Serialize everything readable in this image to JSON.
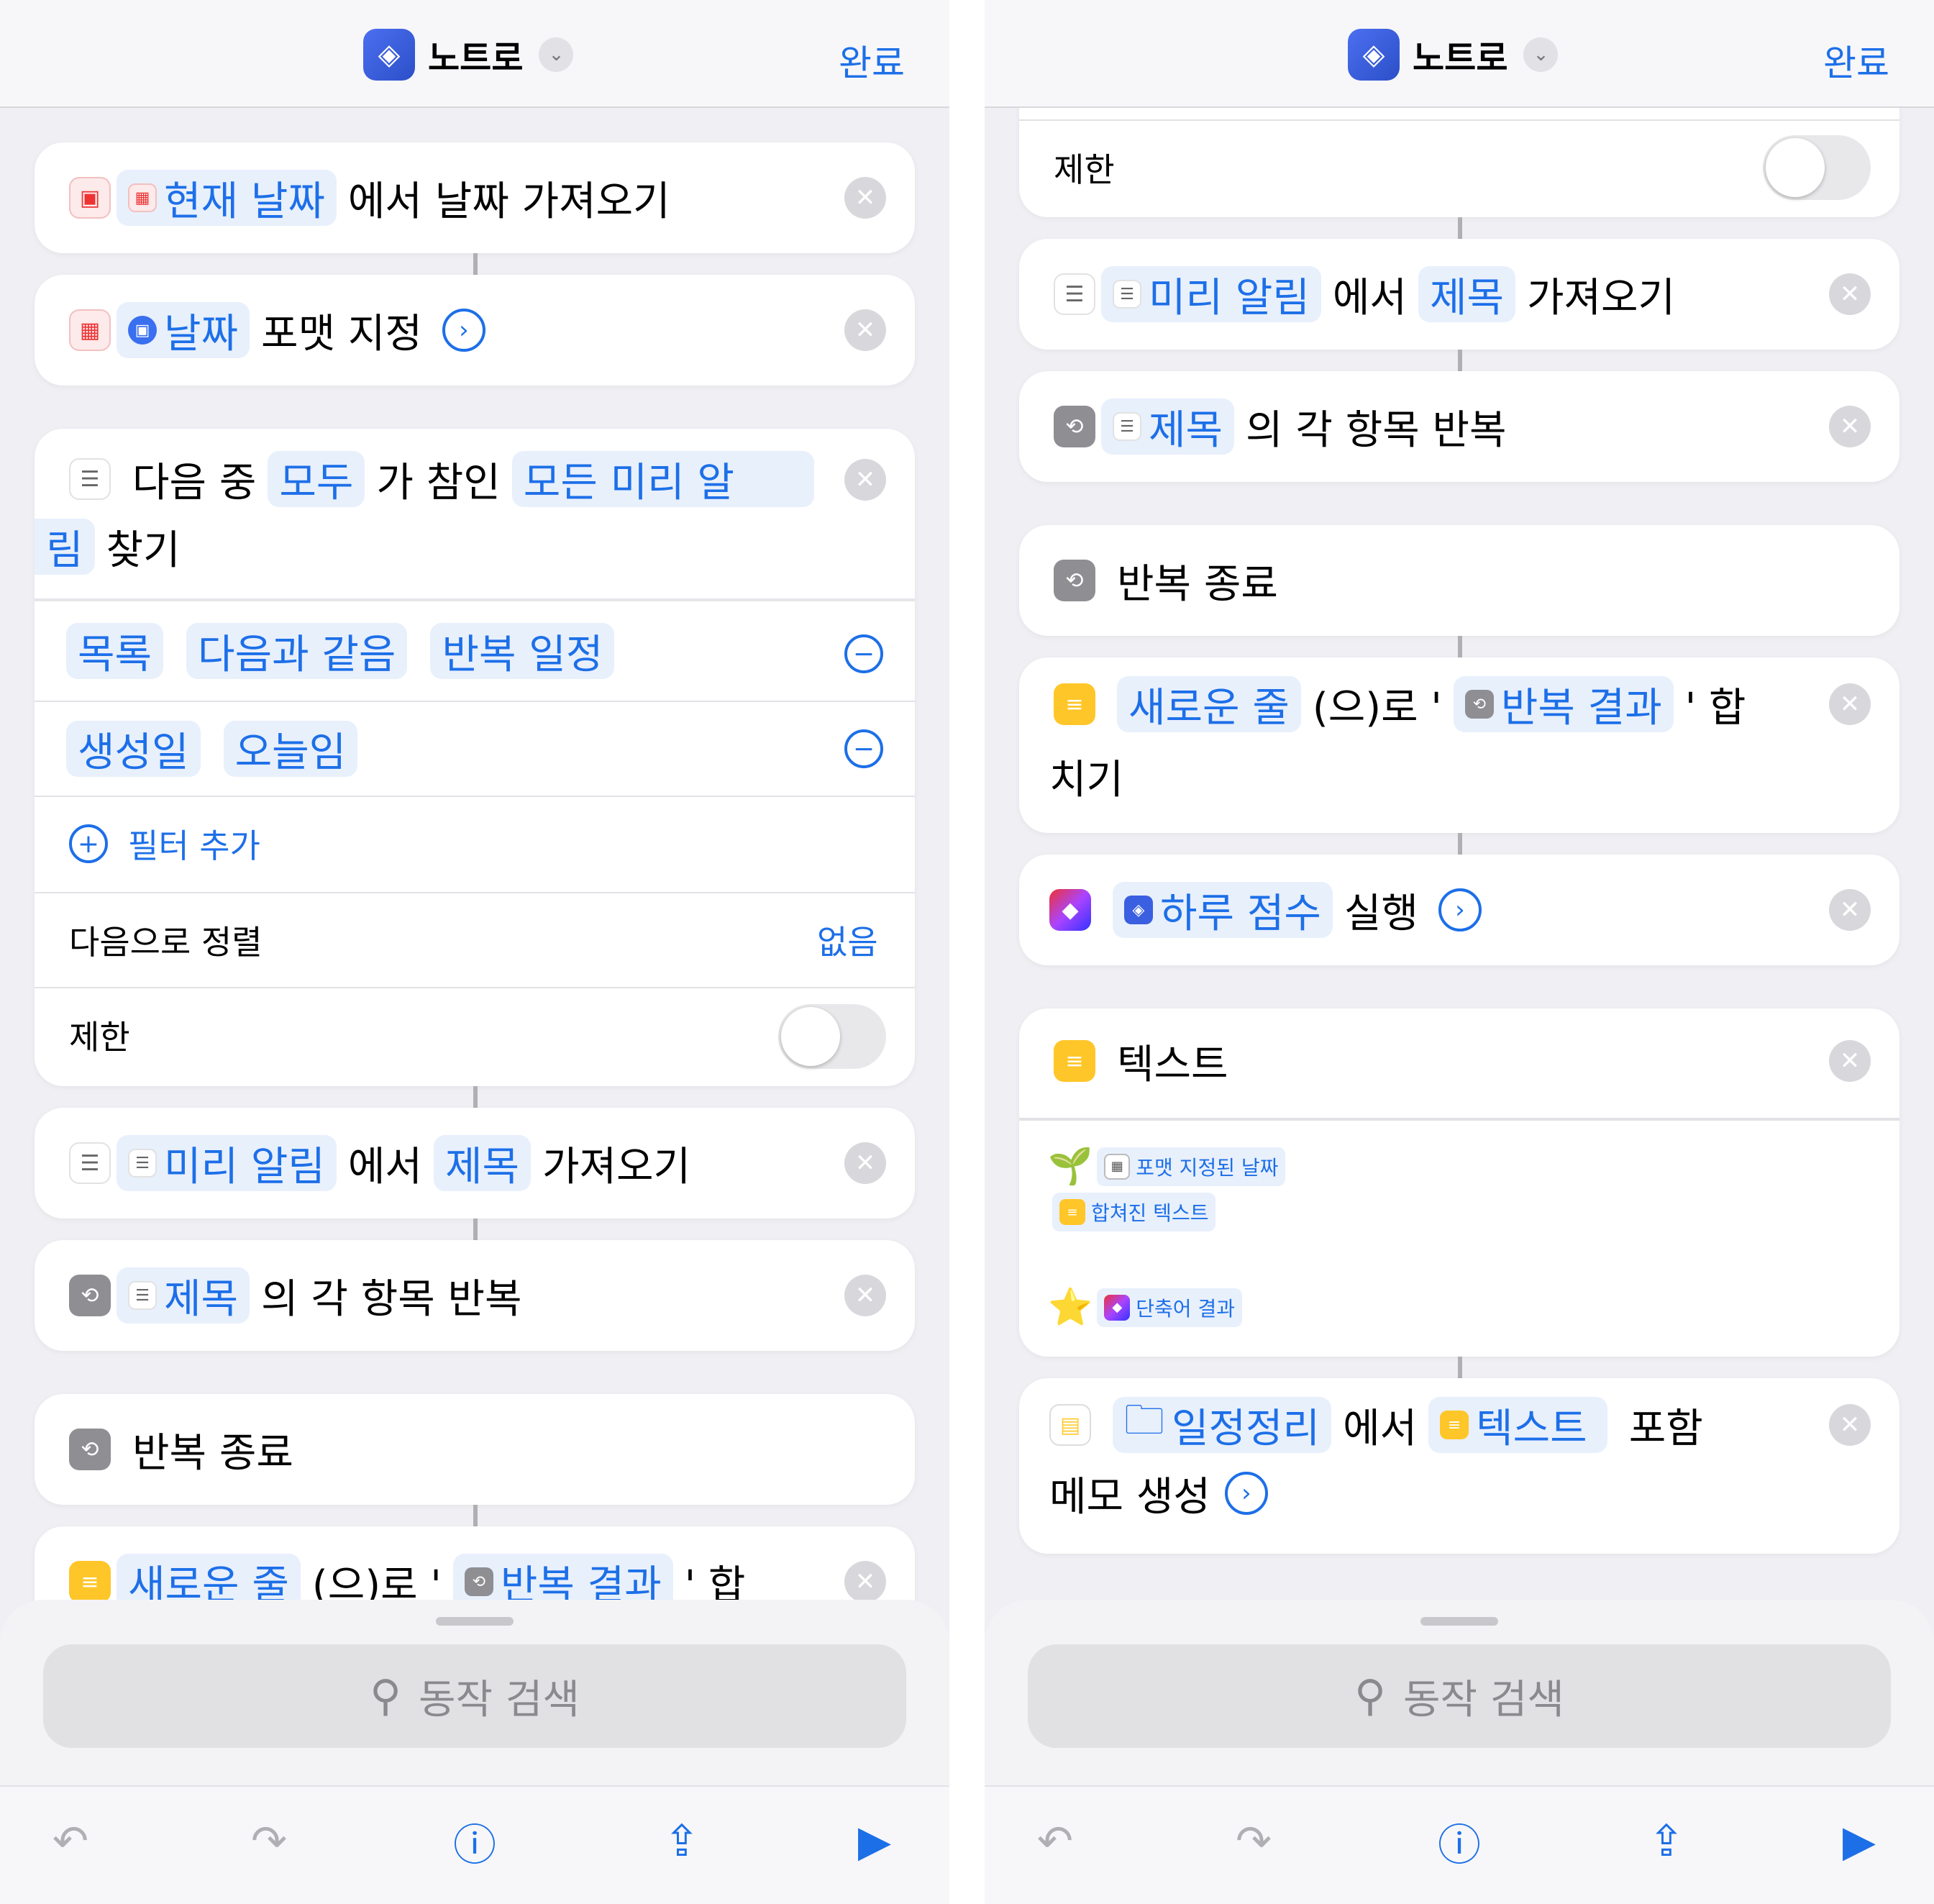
{
  "header": {
    "title": "노트로",
    "done_label": "완료"
  },
  "search": {
    "placeholder": "동작 검색"
  },
  "left": {
    "a1": {
      "token": "현재 날짜",
      "text": "에서 날짜 가져오기"
    },
    "a2": {
      "token": "날짜",
      "text": "포맷 지정"
    },
    "find": {
      "t1": "다음 중",
      "tok_all": "모두",
      "t2": "가 참인",
      "tok_rem_a": "모든 미리 알",
      "tok_rem_b": "림",
      "t3": "찾기"
    },
    "filter1": {
      "a": "목록",
      "b": "다음과 같음",
      "c": "반복 일정"
    },
    "filter2": {
      "a": "생성일",
      "b": "오늘임"
    },
    "add_filter": "필터 추가",
    "sort": {
      "label": "다음으로 정렬",
      "value": "없음"
    },
    "limit": "제한",
    "get": {
      "tok_a": "미리 알림",
      "t1": "에서",
      "tok_b": "제목",
      "t2": "가져오기"
    },
    "repeat": {
      "tok": "제목",
      "text": "의 각 항목 반복"
    },
    "end_repeat": "반복 종료",
    "combine": {
      "tok_a": "새로운 줄",
      "t1": "(으)로 '",
      "tok_b": "반복 결과",
      "t2": "' 합"
    }
  },
  "right": {
    "limit": "제한",
    "get": {
      "tok_a": "미리 알림",
      "t1": "에서",
      "tok_b": "제목",
      "t2": "가져오기"
    },
    "repeat": {
      "tok": "제목",
      "text": "의 각 항목 반복"
    },
    "end_repeat": "반복 종료",
    "combine": {
      "tok_a": "새로운 줄",
      "t1": "(으)로 '",
      "tok_b": "반복 결과",
      "t2": "' 합",
      "t3": "치기"
    },
    "run": {
      "tok": "하루 점수",
      "text": "실행"
    },
    "text_action": {
      "title": "텍스트",
      "sprout": "🌱",
      "tok1": "포맷 지정된 날짜",
      "tok2": "합쳐진 텍스트",
      "star": "⭐",
      "tok3": "단축어 결과"
    },
    "note": {
      "tok_a": "일정정리",
      "t1": "에서",
      "tok_b": "텍스트",
      "t2": "포함",
      "t3": "메모 생성"
    }
  }
}
